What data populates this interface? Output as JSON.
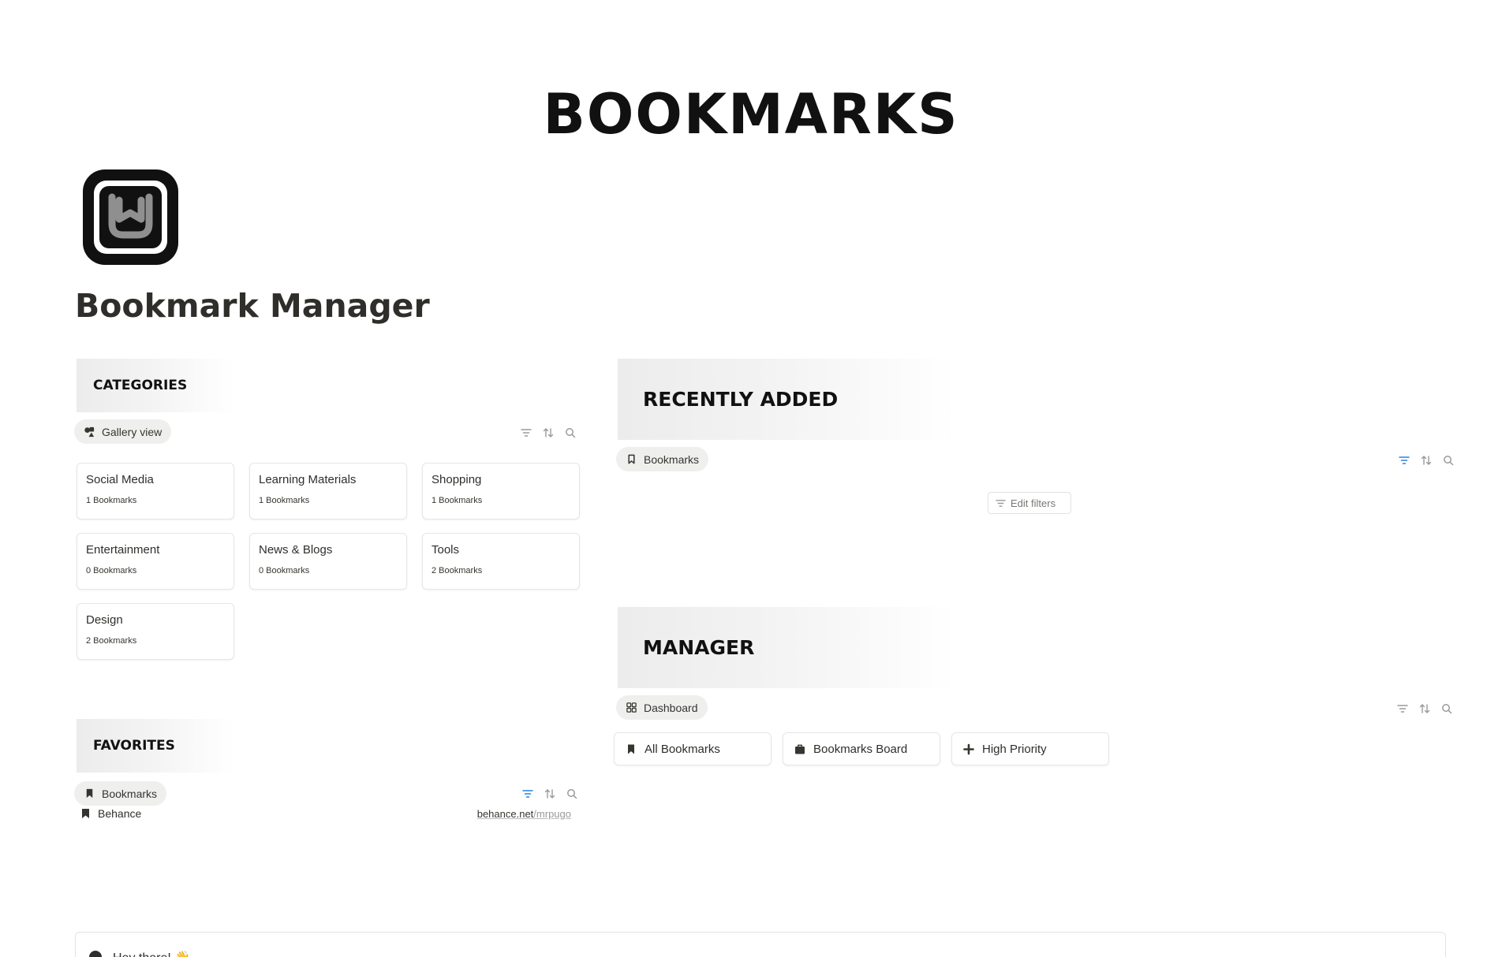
{
  "banner": {
    "title": "BOOKMARKS"
  },
  "page": {
    "title": "Bookmark Manager"
  },
  "categories": {
    "heading": "CATEGORIES",
    "view_label": "Gallery view",
    "cards": [
      {
        "title": "Social Media",
        "count": "1 Bookmarks"
      },
      {
        "title": "Learning Materials",
        "count": "1 Bookmarks"
      },
      {
        "title": "Shopping",
        "count": "1 Bookmarks"
      },
      {
        "title": "Entertainment",
        "count": "0 Bookmarks"
      },
      {
        "title": "News & Blogs",
        "count": "0 Bookmarks"
      },
      {
        "title": "Tools",
        "count": "2 Bookmarks"
      },
      {
        "title": "Design",
        "count": "2 Bookmarks"
      }
    ]
  },
  "favorites": {
    "heading": "FAVORITES",
    "view_label": "Bookmarks",
    "items": [
      {
        "name": "Behance",
        "url_domain": "behance.net",
        "url_path": "/mrpugo"
      }
    ]
  },
  "recently_added": {
    "heading": "RECENTLY ADDED",
    "view_label": "Bookmarks",
    "edit_filters_label": "Edit filters"
  },
  "manager": {
    "heading": "MANAGER",
    "view_label": "Dashboard",
    "buttons": [
      {
        "label": "All Bookmarks",
        "icon": "bookmark-icon"
      },
      {
        "label": "Bookmarks Board",
        "icon": "briefcase-icon"
      },
      {
        "label": "High Priority",
        "icon": "plus-icon"
      }
    ]
  },
  "callout": {
    "text": "Hey there! 👋"
  },
  "colors": {
    "active_filter": "#2383e2",
    "icon_gray": "#9b9a97",
    "text": "#37352f"
  }
}
